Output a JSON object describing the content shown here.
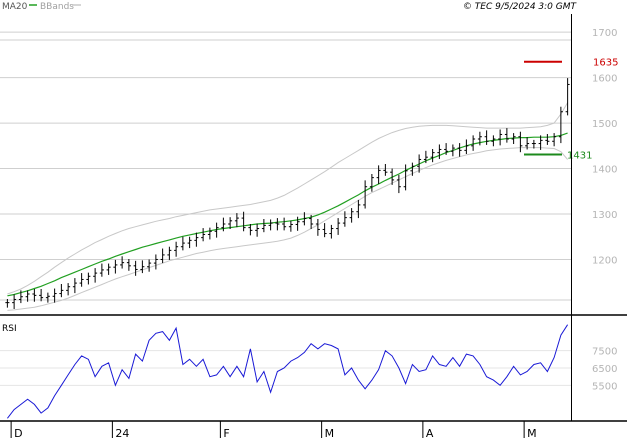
{
  "header": {
    "series_label": "MA20",
    "bbands_label": "BBands",
    "source": "© TEC 9/5/2024 3:0 GMT"
  },
  "colors": {
    "ma": "#22a022",
    "bbands": "#c8c8c8",
    "price": "#000000",
    "rsi": "#1a1ad6",
    "resistance": "#cc0000",
    "support": "#1c8a1c",
    "grid": "#cfcfcf"
  },
  "chart_data": [
    {
      "type": "ohlc",
      "title": "",
      "ylim": [
        1080,
        1740
      ],
      "yticks": [
        1200,
        1300,
        1400,
        1500,
        1600,
        1700
      ],
      "ytick_labels": [
        "1200",
        "1300",
        "1400",
        "1500",
        "1600",
        "1700"
      ],
      "xticks": [
        "D",
        "24",
        "F",
        "M",
        "A",
        "M"
      ],
      "levels": [
        {
          "name": "1635",
          "value": 1635,
          "color": "#cc0000"
        },
        {
          "name": "1431",
          "value": 1431,
          "color": "#1c8a1c"
        }
      ],
      "ma20": [
        1120,
        1123,
        1127,
        1131,
        1136,
        1141,
        1147,
        1153,
        1160,
        1166,
        1172,
        1178,
        1184,
        1190,
        1196,
        1201,
        1207,
        1212,
        1217,
        1222,
        1227,
        1231,
        1235,
        1239,
        1243,
        1247,
        1251,
        1254,
        1257,
        1260,
        1263,
        1266,
        1268,
        1270,
        1272,
        1274,
        1276,
        1278,
        1279,
        1280,
        1282,
        1283,
        1285,
        1287,
        1290,
        1293,
        1298,
        1304,
        1311,
        1318,
        1326,
        1334,
        1342,
        1351,
        1359,
        1366,
        1374,
        1381,
        1388,
        1396,
        1403,
        1410,
        1417,
        1423,
        1429,
        1435,
        1440,
        1445,
        1450,
        1454,
        1457,
        1460,
        1462,
        1464,
        1466,
        1467,
        1468,
        1468,
        1469,
        1469,
        1469,
        1470,
        1473,
        1478
      ],
      "bb_upper": [
        1124,
        1129,
        1135,
        1143,
        1152,
        1162,
        1172,
        1183,
        1193,
        1203,
        1212,
        1221,
        1229,
        1237,
        1244,
        1251,
        1257,
        1263,
        1268,
        1272,
        1276,
        1280,
        1284,
        1287,
        1290,
        1294,
        1297,
        1300,
        1303,
        1306,
        1309,
        1311,
        1313,
        1315,
        1317,
        1319,
        1321,
        1324,
        1327,
        1330,
        1335,
        1341,
        1349,
        1357,
        1366,
        1375,
        1384,
        1393,
        1403,
        1413,
        1422,
        1431,
        1440,
        1449,
        1458,
        1466,
        1473,
        1479,
        1484,
        1488,
        1491,
        1493,
        1494,
        1495,
        1495,
        1495,
        1494,
        1493,
        1492,
        1491,
        1490,
        1489,
        1489,
        1489,
        1489,
        1489,
        1489,
        1490,
        1491,
        1492,
        1495,
        1500,
        1520,
        1545
      ],
      "bb_lower": [
        1088,
        1089,
        1091,
        1093,
        1095,
        1098,
        1102,
        1106,
        1110,
        1115,
        1121,
        1127,
        1133,
        1139,
        1145,
        1151,
        1157,
        1162,
        1167,
        1172,
        1177,
        1182,
        1187,
        1192,
        1197,
        1201,
        1205,
        1209,
        1213,
        1216,
        1219,
        1222,
        1224,
        1226,
        1228,
        1230,
        1232,
        1234,
        1236,
        1238,
        1240,
        1243,
        1247,
        1253,
        1260,
        1268,
        1276,
        1285,
        1294,
        1303,
        1312,
        1321,
        1330,
        1339,
        1347,
        1354,
        1361,
        1368,
        1375,
        1382,
        1389,
        1396,
        1402,
        1408,
        1413,
        1418,
        1422,
        1426,
        1430,
        1433,
        1436,
        1439,
        1441,
        1443,
        1444,
        1445,
        1446,
        1446,
        1446,
        1446,
        1445,
        1444,
        1437,
        1420
      ],
      "close": [
        1105,
        1112,
        1118,
        1124,
        1121,
        1116,
        1119,
        1125,
        1132,
        1140,
        1148,
        1156,
        1163,
        1170,
        1177,
        1183,
        1188,
        1193,
        1186,
        1178,
        1184,
        1192,
        1200,
        1210,
        1220,
        1228,
        1236,
        1242,
        1248,
        1255,
        1262,
        1270,
        1278,
        1285,
        1291,
        1270,
        1264,
        1268,
        1275,
        1280,
        1278,
        1272,
        1277,
        1283,
        1290,
        1278,
        1266,
        1257,
        1268,
        1280,
        1292,
        1305,
        1320,
        1360,
        1380,
        1396,
        1392,
        1375,
        1360,
        1395,
        1405,
        1420,
        1425,
        1435,
        1442,
        1438,
        1445,
        1440,
        1450,
        1465,
        1470,
        1460,
        1465,
        1475,
        1465,
        1470,
        1450,
        1455,
        1455,
        1462,
        1460,
        1470,
        1525,
        1585
      ]
    },
    {
      "type": "line",
      "title": "RSI",
      "ylim": [
        35,
        95
      ],
      "yticks": [
        55,
        65,
        75
      ],
      "ytick_labels": [
        "5500",
        "6500",
        "7500"
      ],
      "values": [
        36,
        41,
        44,
        47,
        44,
        39,
        42,
        49,
        55,
        61,
        67,
        72,
        70,
        60,
        66,
        68,
        55,
        64,
        59,
        73,
        69,
        81,
        85,
        86,
        81,
        88,
        67,
        70,
        66,
        70,
        60,
        61,
        66,
        60,
        66,
        60,
        76,
        57,
        63,
        51,
        63,
        65,
        69,
        71,
        74,
        79,
        76,
        79,
        78,
        76,
        61,
        65,
        58,
        53,
        58,
        64,
        75,
        72,
        65,
        56,
        67,
        63,
        64,
        72,
        67,
        66,
        71,
        66,
        73,
        72,
        67,
        60,
        58,
        55,
        60,
        66,
        61,
        63,
        67,
        68,
        63,
        71,
        84,
        90
      ]
    }
  ]
}
